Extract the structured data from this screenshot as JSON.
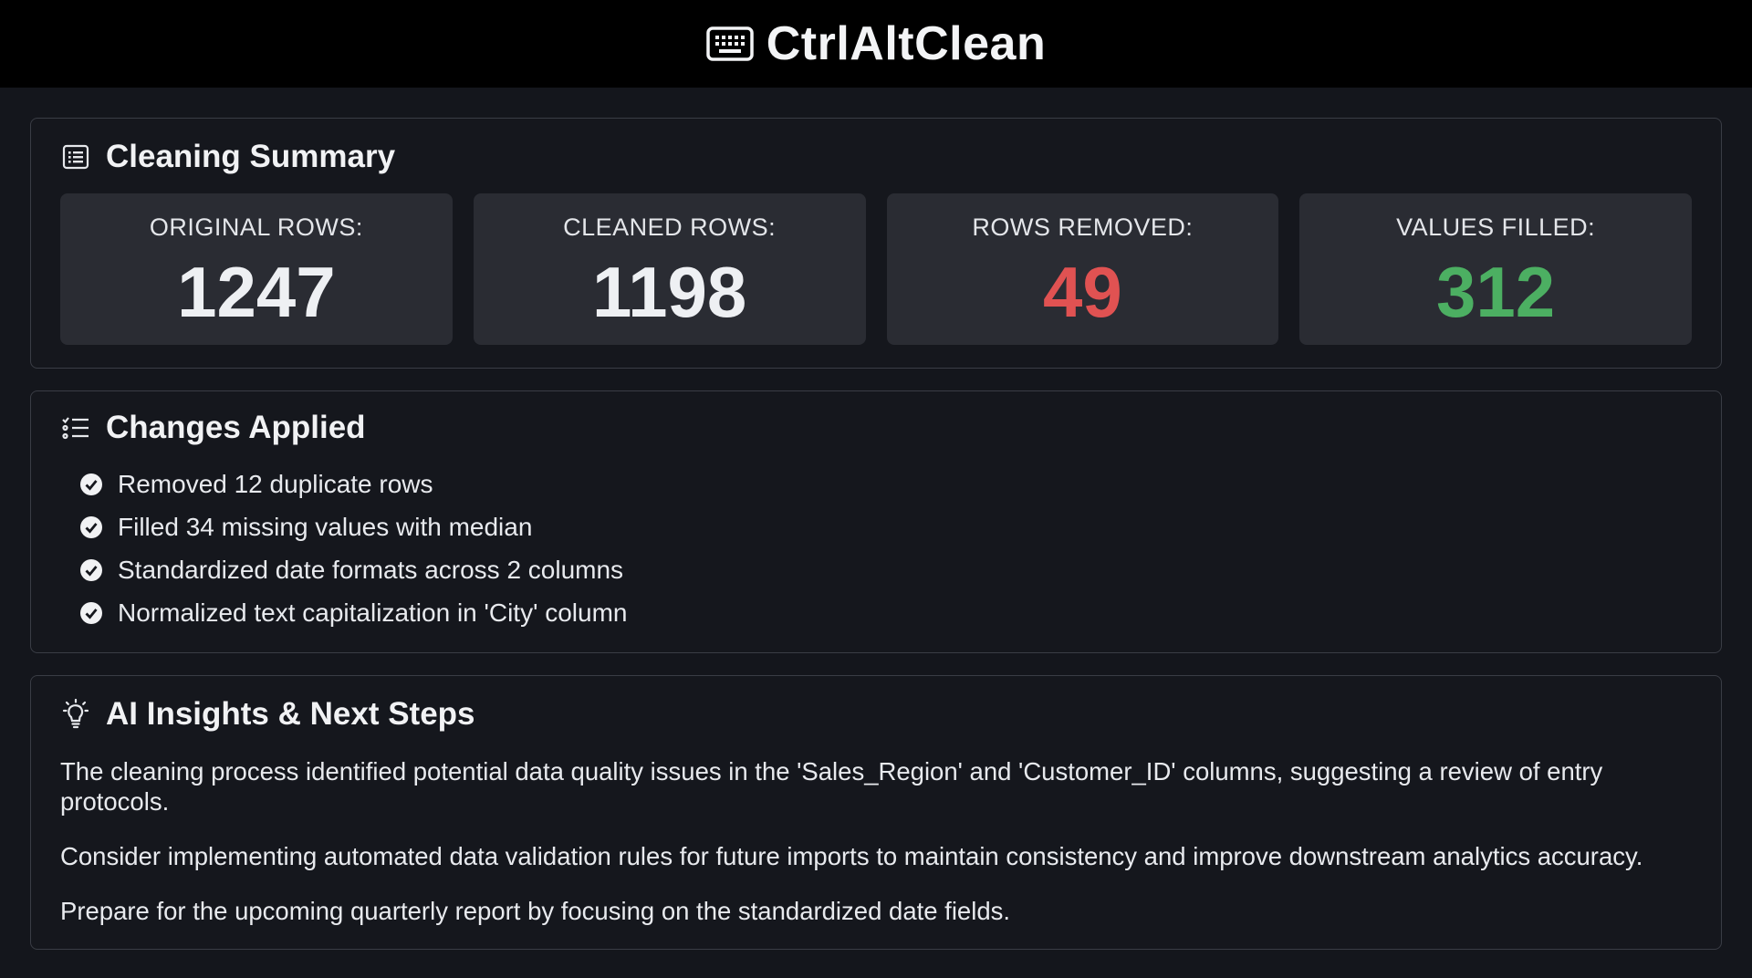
{
  "app": {
    "title": "CtrlAltClean",
    "logo_icon": "keyboard-icon"
  },
  "summary": {
    "title": "Cleaning Summary",
    "icon": "list-document-icon",
    "stats": [
      {
        "label": "ORIGINAL ROWS:",
        "value": "1247",
        "color": "#eef0f3"
      },
      {
        "label": "CLEANED ROWS:",
        "value": "1198",
        "color": "#eef0f3"
      },
      {
        "label": "ROWS REMOVED:",
        "value": "49",
        "color": "#e05252"
      },
      {
        "label": "VALUES FILLED:",
        "value": "312",
        "color": "#4caf62"
      }
    ]
  },
  "changes": {
    "title": "Changes Applied",
    "icon": "checklist-icon",
    "items": [
      "Removed 12 duplicate rows",
      "Filled 34 missing values with median",
      "Standardized date formats across 2 columns",
      "Normalized text capitalization in 'City' column"
    ]
  },
  "insights": {
    "title": "AI Insights & Next Steps",
    "icon": "lightbulb-icon",
    "paragraphs": [
      "The cleaning process identified potential data quality issues in the 'Sales_Region' and 'Customer_ID' columns, suggesting a review of entry protocols.",
      "Consider implementing automated data validation rules for future imports to maintain consistency and improve downstream analytics accuracy.",
      "Prepare for the upcoming quarterly report by focusing on the standardized date fields."
    ]
  }
}
